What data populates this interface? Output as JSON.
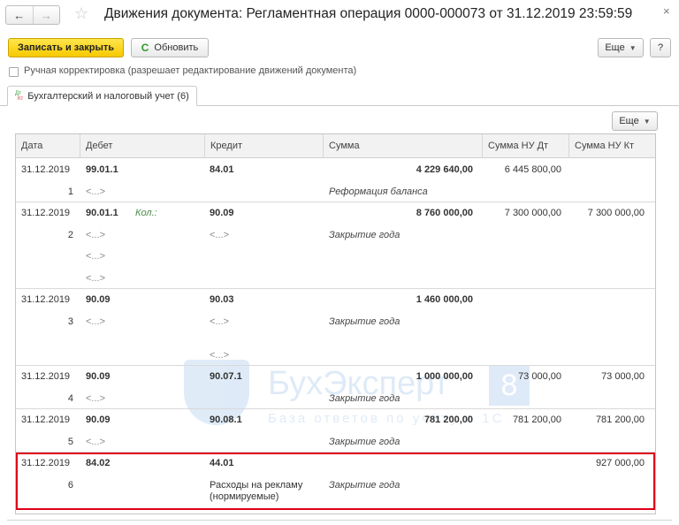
{
  "window": {
    "title": "Движения документа: Регламентная операция 0000-000073 от 31.12.2019 23:59:59",
    "close": "×",
    "back": "←",
    "forward": "→",
    "star": "☆"
  },
  "toolbar": {
    "save_close_label": "Записать и закрыть",
    "refresh_label": "Обновить",
    "refresh_glyph": "C",
    "more_label": "Еще",
    "help_label": "?"
  },
  "manual_edit": {
    "label": "Ручная корректировка (разрешает редактирование движений документа)"
  },
  "tabs": [
    {
      "label": "Бухгалтерский и налоговый учет (6)",
      "icon_top": "Дт",
      "icon_bottom": "Кт"
    }
  ],
  "grid": {
    "more_label": "Еще",
    "columns": [
      "Дата",
      "Дебет",
      "Кредит",
      "Сумма",
      "Сумма НУ Дт",
      "Сумма НУ Кт"
    ],
    "rows": [
      {
        "date": "31.12.2019",
        "num": "1",
        "debit": "99.01.1",
        "debit_qty": "",
        "debit_sub": [
          "<...>"
        ],
        "credit": "84.01",
        "credit_sub": [],
        "sum": "4 229 640,00",
        "content": "Реформация баланса",
        "nu_dt": "6 445 800,00",
        "nu_kt": ""
      },
      {
        "date": "31.12.2019",
        "num": "2",
        "debit": "90.01.1",
        "debit_qty": "Кол.:",
        "debit_sub": [
          "<...>",
          "<...>",
          "<...>"
        ],
        "credit": "90.09",
        "credit_sub": [
          "<...>"
        ],
        "sum": "8 760 000,00",
        "content": "Закрытие года",
        "nu_dt": "7 300 000,00",
        "nu_kt": "7 300 000,00"
      },
      {
        "date": "31.12.2019",
        "num": "3",
        "debit": "90.09",
        "debit_qty": "",
        "debit_sub": [
          "<...>"
        ],
        "credit": "90.03",
        "credit_sub": [
          "<...>",
          "<...>"
        ],
        "sum": "1 460 000,00",
        "content": "Закрытие года",
        "nu_dt": "",
        "nu_kt": ""
      },
      {
        "date": "31.12.2019",
        "num": "4",
        "debit": "90.09",
        "debit_qty": "",
        "debit_sub": [
          "<...>"
        ],
        "credit": "90.07.1",
        "credit_sub": [],
        "sum": "1 000 000,00",
        "content": "Закрытие года",
        "nu_dt": "73 000,00",
        "nu_kt": "73 000,00"
      },
      {
        "date": "31.12.2019",
        "num": "5",
        "debit": "90.09",
        "debit_qty": "",
        "debit_sub": [
          "<...>"
        ],
        "credit": "90.08.1",
        "credit_sub": [],
        "sum": "781 200,00",
        "content": "Закрытие года",
        "nu_dt": "781 200,00",
        "nu_kt": "781 200,00"
      },
      {
        "date": "31.12.2019",
        "num": "6",
        "debit": "84.02",
        "debit_qty": "",
        "debit_sub": [],
        "credit": "44.01",
        "credit_sub": [
          "Расходы на рекламу",
          "(нормируемые)"
        ],
        "sum": "",
        "content": "Закрытие года",
        "nu_dt": "",
        "nu_kt": "927 000,00"
      }
    ]
  },
  "watermark": {
    "brand": "БухЭксперт",
    "digit": "8",
    "tagline": "База ответов по учёту в 1С"
  }
}
